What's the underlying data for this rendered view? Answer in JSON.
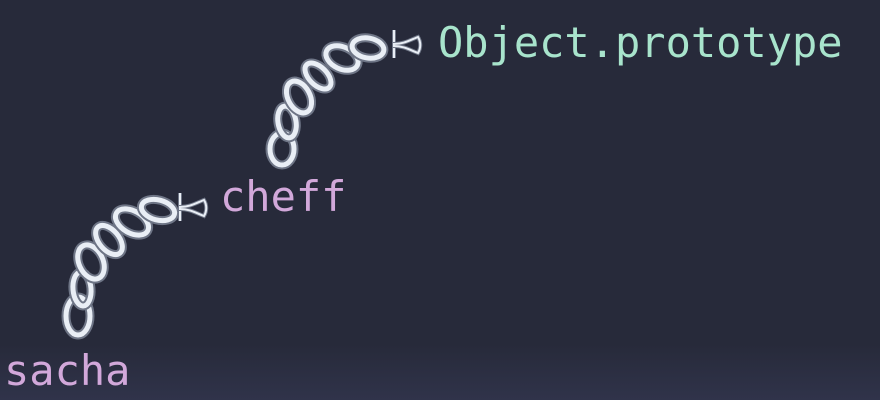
{
  "diagram": {
    "nodes": [
      {
        "id": "sacha",
        "label": "sacha",
        "color": "#d2a8da"
      },
      {
        "id": "cheff",
        "label": "cheff",
        "color": "#d2a8da"
      },
      {
        "id": "object-prototype",
        "label": "Object.prototype",
        "color": "#a8e4cc"
      }
    ],
    "links": [
      {
        "from": "sacha",
        "to": "cheff",
        "icon": "chain-icon"
      },
      {
        "from": "cheff",
        "to": "object-prototype",
        "icon": "chain-icon"
      }
    ],
    "colors": {
      "background": "#272a3a",
      "chain_fill": "#e9eef5",
      "chain_stroke": "#6e7586"
    }
  }
}
